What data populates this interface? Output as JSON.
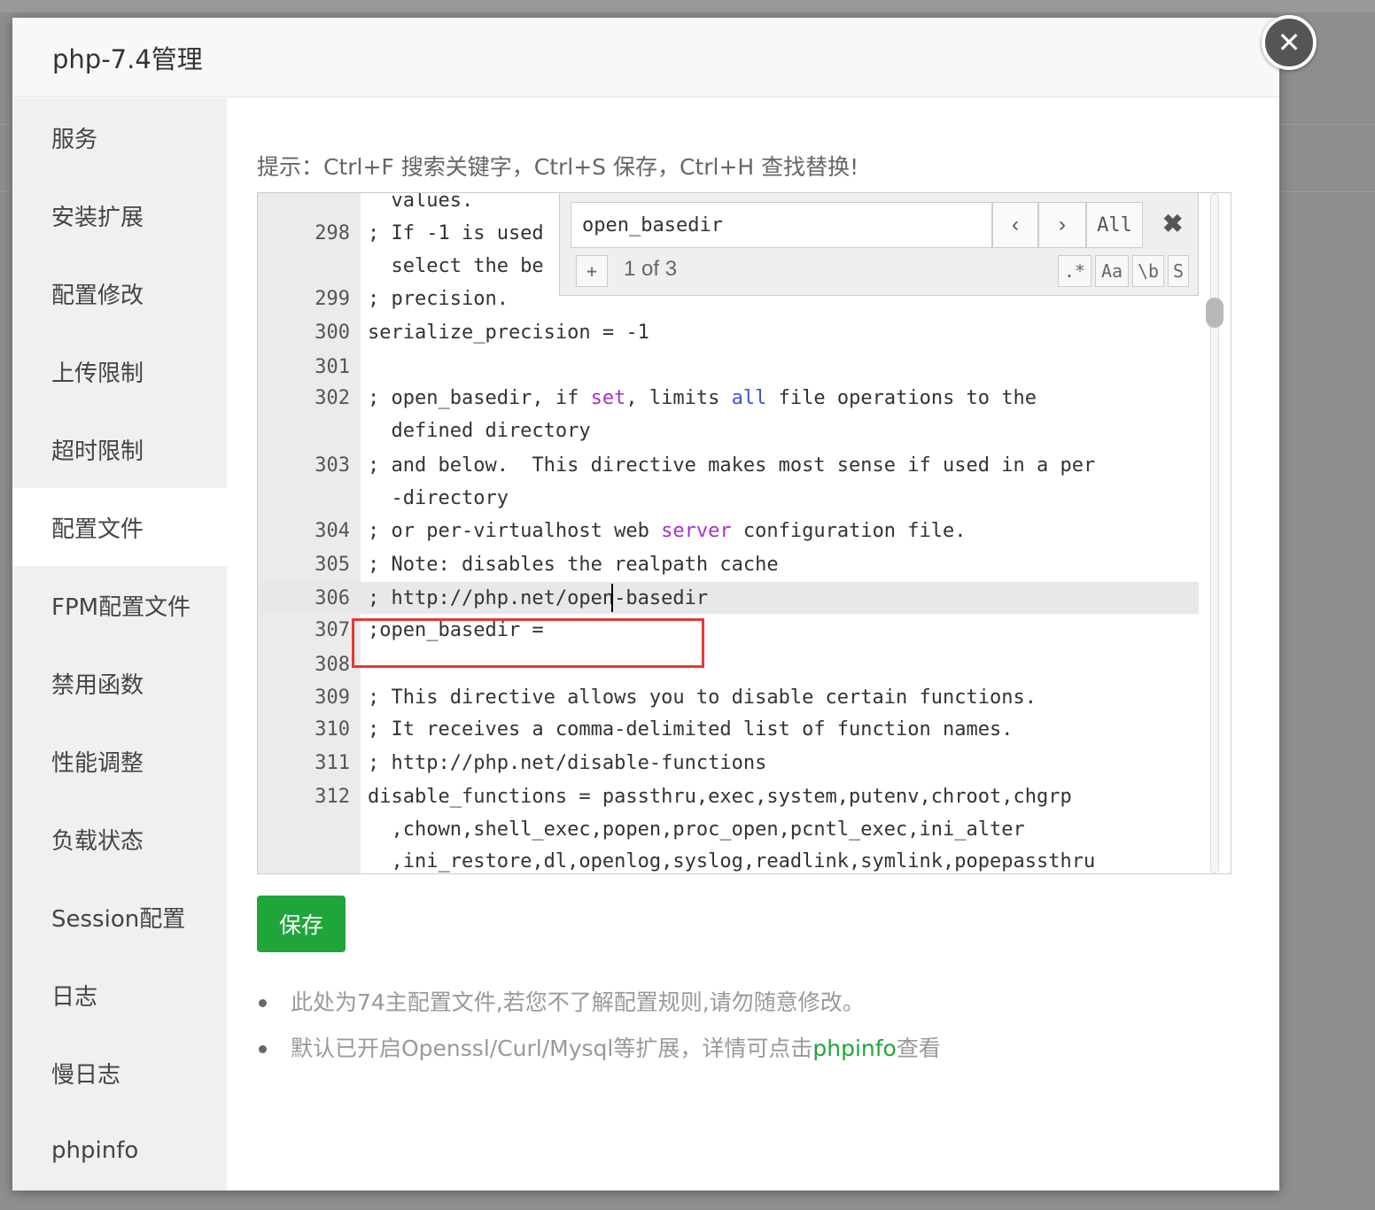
{
  "modal": {
    "title": "php-7.4管理",
    "close_icon": "close-icon"
  },
  "sidebar": {
    "items": [
      {
        "label": "服务"
      },
      {
        "label": "安装扩展"
      },
      {
        "label": "配置修改"
      },
      {
        "label": "上传限制"
      },
      {
        "label": "超时限制"
      },
      {
        "label": "配置文件",
        "active": true
      },
      {
        "label": "FPM配置文件"
      },
      {
        "label": "禁用函数"
      },
      {
        "label": "性能调整"
      },
      {
        "label": "负载状态"
      },
      {
        "label": "Session配置"
      },
      {
        "label": "日志"
      },
      {
        "label": "慢日志"
      },
      {
        "label": "phpinfo"
      }
    ]
  },
  "main": {
    "tip": "提示：Ctrl+F 搜索关键字，Ctrl+S 保存，Ctrl+H 查找替换!",
    "save_label": "保存",
    "notes": [
      "此处为74主配置文件,若您不了解配置规则,请勿随意修改。",
      "默认已开启Openssl/Curl/Mysql等扩展，详情可点击"
    ],
    "note_link": "phpinfo",
    "note_suffix": "查看"
  },
  "search": {
    "query": "open_basedir",
    "prev_icon": "chevron-left-icon",
    "next_icon": "chevron-right-icon",
    "all_label": "All",
    "add_label": "+",
    "count": "1 of 3",
    "regex_label": ".*",
    "case_label": "Aa",
    "word_label": "\\b",
    "selection_label": "S"
  },
  "editor": {
    "lines": [
      {
        "n": "",
        "t": "  values."
      },
      {
        "n": "298",
        "t": "; If -1 is used"
      },
      {
        "n": "",
        "t": "  select the be"
      },
      {
        "n": "299",
        "t": "; precision."
      },
      {
        "n": "300",
        "t": "serialize_precision = -1"
      },
      {
        "n": "301",
        "t": ""
      },
      {
        "n": "302",
        "t": "; open_basedir, if set, limits all file operations to the"
      },
      {
        "n": "",
        "t": "  defined directory"
      },
      {
        "n": "303",
        "t": "; and below.  This directive makes most sense if used in a per"
      },
      {
        "n": "",
        "t": "  -directory"
      },
      {
        "n": "304",
        "t": "; or per-virtualhost web server configuration file."
      },
      {
        "n": "305",
        "t": "; Note: disables the realpath cache"
      },
      {
        "n": "306",
        "t": "; http://php.net/open-basedir"
      },
      {
        "n": "307",
        "t": ";open_basedir ="
      },
      {
        "n": "308",
        "t": ""
      },
      {
        "n": "309",
        "t": "; This directive allows you to disable certain functions."
      },
      {
        "n": "310",
        "t": "; It receives a comma-delimited list of function names."
      },
      {
        "n": "311",
        "t": "; http://php.net/disable-functions"
      },
      {
        "n": "312",
        "t": "disable_functions = passthru,exec,system,putenv,chroot,chgrp"
      },
      {
        "n": "",
        "t": "  ,chown,shell_exec,popen,proc_open,pcntl_exec,ini_alter"
      },
      {
        "n": "",
        "t": "  ,ini_restore,dl,openlog,syslog,readlink,symlink,popepassthru"
      }
    ]
  }
}
